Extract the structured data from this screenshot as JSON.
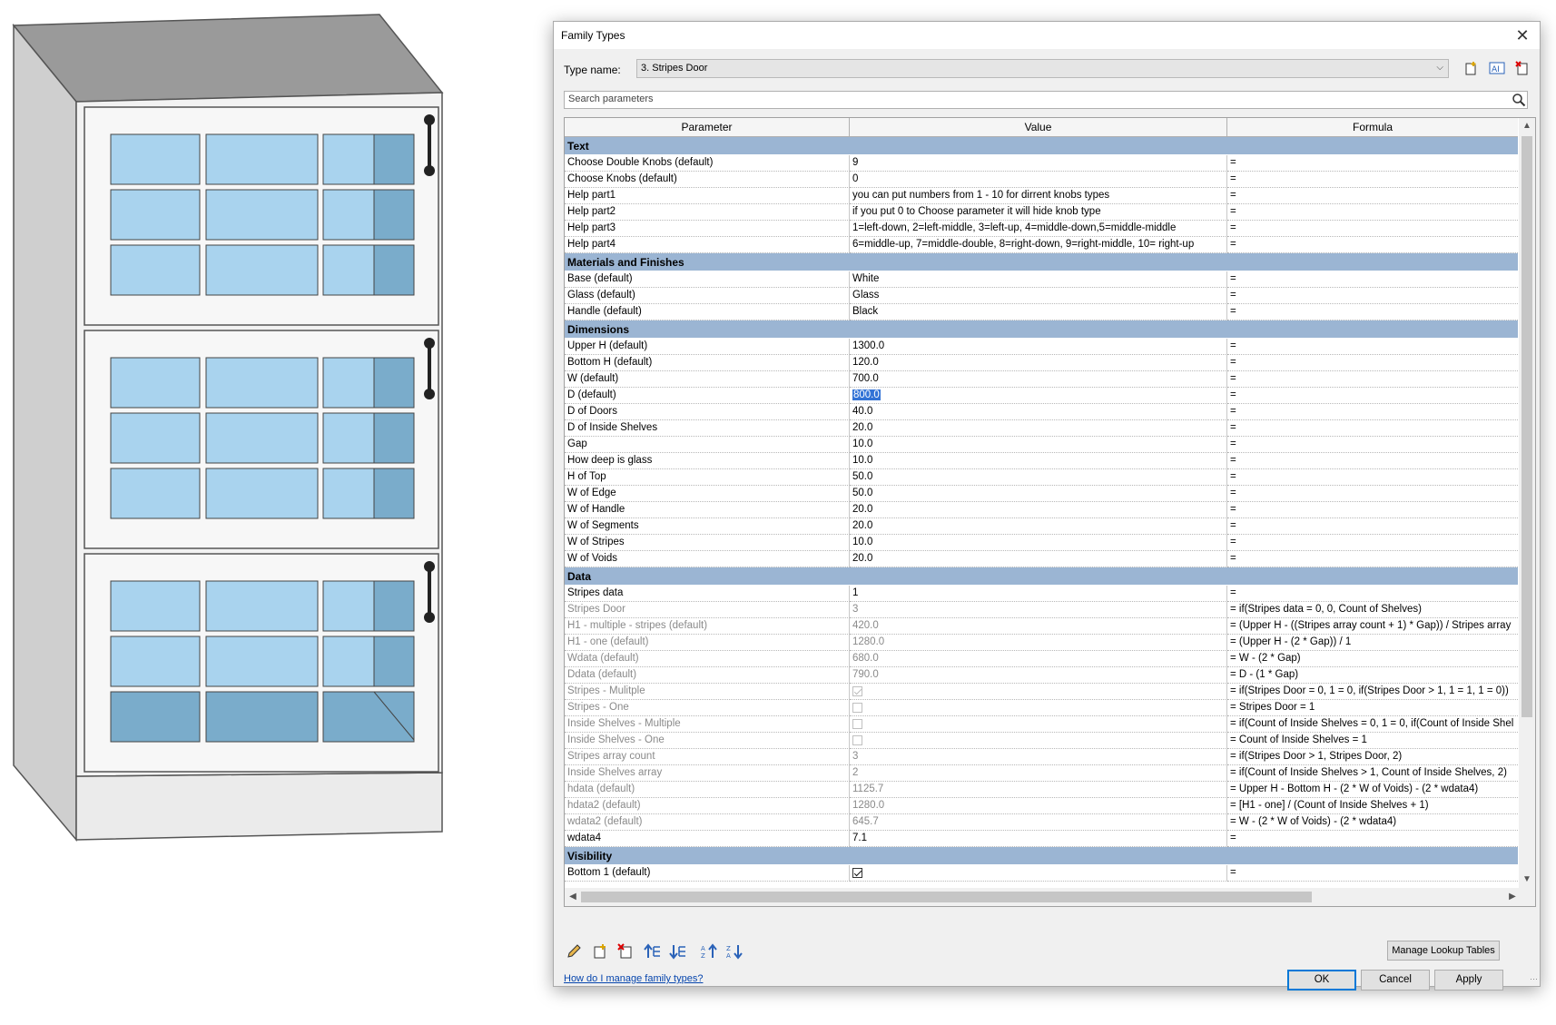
{
  "dialog": {
    "title": "Family Types",
    "close_glyph": "✕",
    "type_label": "Type name:",
    "type_value": "3. Stripes Door",
    "search_placeholder": "Search parameters",
    "columns": [
      "Parameter",
      "Value",
      "Formula"
    ],
    "groups": [
      {
        "name": "Text",
        "rows": [
          {
            "p": "Choose Double Knobs (default)",
            "v": "9",
            "f": "="
          },
          {
            "p": "Choose Knobs (default)",
            "v": "0",
            "f": "="
          },
          {
            "p": "Help part1",
            "v": "you can put numbers from 1 - 10 for dirrent knobs types",
            "f": "="
          },
          {
            "p": "Help part2",
            "v": "if you put 0 to Choose parameter it will hide knob type",
            "f": "="
          },
          {
            "p": "Help part3",
            "v": "1=left-down, 2=left-middle, 3=left-up, 4=middle-down,5=middle-middle",
            "f": "="
          },
          {
            "p": "Help part4",
            "v": "6=middle-up, 7=middle-double, 8=right-down, 9=right-middle, 10= right-up",
            "f": "="
          }
        ]
      },
      {
        "name": "Materials and Finishes",
        "rows": [
          {
            "p": "Base (default)",
            "v": "White",
            "f": "="
          },
          {
            "p": "Glass (default)",
            "v": "Glass",
            "f": "="
          },
          {
            "p": "Handle (default)",
            "v": "Black",
            "f": "="
          }
        ]
      },
      {
        "name": "Dimensions",
        "rows": [
          {
            "p": "Upper H (default)",
            "v": "1300.0",
            "f": "="
          },
          {
            "p": "Bottom H (default)",
            "v": "120.0",
            "f": "="
          },
          {
            "p": "W (default)",
            "v": "700.0",
            "f": "="
          },
          {
            "p": "D (default)",
            "v": "800.0",
            "f": "=",
            "selected": true
          },
          {
            "p": "D of Doors",
            "v": "40.0",
            "f": "="
          },
          {
            "p": "D of Inside Shelves",
            "v": "20.0",
            "f": "="
          },
          {
            "p": "Gap",
            "v": "10.0",
            "f": "="
          },
          {
            "p": "How deep is glass",
            "v": "10.0",
            "f": "="
          },
          {
            "p": "H of Top",
            "v": "50.0",
            "f": "="
          },
          {
            "p": "W of Edge",
            "v": "50.0",
            "f": "="
          },
          {
            "p": "W of Handle",
            "v": "20.0",
            "f": "="
          },
          {
            "p": "W of Segments",
            "v": "20.0",
            "f": "="
          },
          {
            "p": "W of Stripes",
            "v": "10.0",
            "f": "="
          },
          {
            "p": "W of Voids",
            "v": "20.0",
            "f": "="
          }
        ]
      },
      {
        "name": "Data",
        "rows": [
          {
            "p": "Stripes data",
            "v": "1",
            "f": "="
          },
          {
            "p": "Stripes Door",
            "v": "3",
            "f": "= if(Stripes data = 0, 0, Count of Shelves)",
            "ro": true
          },
          {
            "p": "H1 - multiple - stripes (default)",
            "v": "420.0",
            "f": "= (Upper H - ((Stripes array count + 1) * Gap)) / Stripes array",
            "ro": true
          },
          {
            "p": "H1 - one (default)",
            "v": "1280.0",
            "f": "= (Upper H - (2 * Gap)) / 1",
            "ro": true
          },
          {
            "p": "Wdata (default)",
            "v": "680.0",
            "f": "= W - (2 * Gap)",
            "ro": true
          },
          {
            "p": "Ddata (default)",
            "v": "790.0",
            "f": "= D - (1 * Gap)",
            "ro": true
          },
          {
            "p": "Stripes - Mulitple",
            "check": "on",
            "f": "= if(Stripes Door = 0, 1 = 0, if(Stripes Door > 1, 1 = 1, 1 = 0))",
            "ro": true
          },
          {
            "p": "Stripes - One",
            "check": "off",
            "f": "= Stripes Door = 1",
            "ro": true
          },
          {
            "p": "Inside Shelves - Multiple",
            "check": "off",
            "f": "= if(Count of Inside Shelves = 0, 1 = 0, if(Count of Inside Shel",
            "ro": true
          },
          {
            "p": "Inside Shelves - One",
            "check": "off",
            "f": "= Count of Inside Shelves = 1",
            "ro": true
          },
          {
            "p": "Stripes array count",
            "v": "3",
            "f": "= if(Stripes Door > 1, Stripes Door, 2)",
            "ro": true
          },
          {
            "p": "Inside Shelves array",
            "v": "2",
            "f": "= if(Count of Inside Shelves > 1, Count of Inside Shelves, 2)",
            "ro": true
          },
          {
            "p": "hdata (default)",
            "v": "1125.7",
            "f": "= Upper H - Bottom H - (2 * W of Voids) - (2 * wdata4)",
            "ro": true
          },
          {
            "p": "hdata2 (default)",
            "v": "1280.0",
            "f": "= [H1 - one] / (Count of Inside Shelves + 1)",
            "ro": true
          },
          {
            "p": "wdata2 (default)",
            "v": "645.7",
            "f": "= W - (2 * W of Voids) - (2 * wdata4)",
            "ro": true
          },
          {
            "p": "wdata4",
            "v": "7.1",
            "f": "="
          }
        ]
      },
      {
        "name": "Visibility",
        "rows": [
          {
            "p": "Bottom 1 (default)",
            "check": "on-dark",
            "f": "="
          }
        ]
      }
    ],
    "buttons": {
      "lookup": "Manage Lookup Tables",
      "ok": "OK",
      "cancel": "Cancel",
      "apply": "Apply"
    },
    "help_link": "How do I manage family types?",
    "icons": {
      "new_type": "new-type-icon",
      "rename_type": "rename-type-icon",
      "delete_type": "delete-type-icon",
      "edit_param": "pencil-icon",
      "new_param": "new-parameter-icon",
      "delete_param": "delete-parameter-icon",
      "move_up": "move-up-icon",
      "move_down": "move-down-icon",
      "sort_asc": "sort-ascending-icon",
      "sort_desc": "sort-descending-icon"
    }
  },
  "colors": {
    "group_header": "#9bb5d3",
    "selection": "#3373d6",
    "glass": "#a9d3ee",
    "glass_dark": "#7aaccb",
    "cabinet_side": "#c8c8c8",
    "cabinet_top": "#9a9a9a"
  }
}
